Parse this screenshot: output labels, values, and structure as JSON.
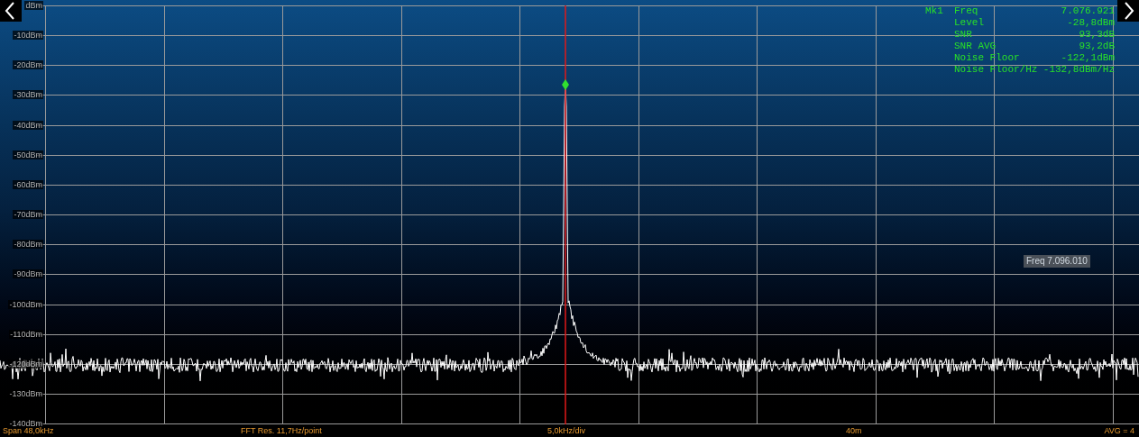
{
  "y_axis": {
    "labels": [
      "dBm",
      "-10dBm",
      "-20dBm",
      "-30dBm",
      "-40dBm",
      "-50dBm",
      "-60dBm",
      "-70dBm",
      "-80dBm",
      "-90dBm",
      "-100dBm",
      "-110dBm",
      "-120dBm",
      "-130dBm",
      "-140dBm"
    ]
  },
  "marker_panel": {
    "marker": "Mk1",
    "rows": [
      {
        "name": "Freq",
        "value": "7.076.921"
      },
      {
        "name": "Level",
        "value": "-28,8dBm"
      },
      {
        "name": "SNR",
        "value": "93,3dB"
      },
      {
        "name": "SNR AVG",
        "value": "93,2dB"
      },
      {
        "name": "Noise Floor",
        "value": "-122,1dBm"
      },
      {
        "name": "Noise Floor/Hz",
        "value": "-132,8dBm/Hz"
      }
    ]
  },
  "cursor_readout": "Freq 7.096.010",
  "status_bar": {
    "span": "Span 48,0kHz",
    "fft_resolution": "FFT Res. 11,7Hz/point",
    "scale": "5,0kHz/div",
    "band": "40m",
    "averaging": "AVG = 4"
  }
}
